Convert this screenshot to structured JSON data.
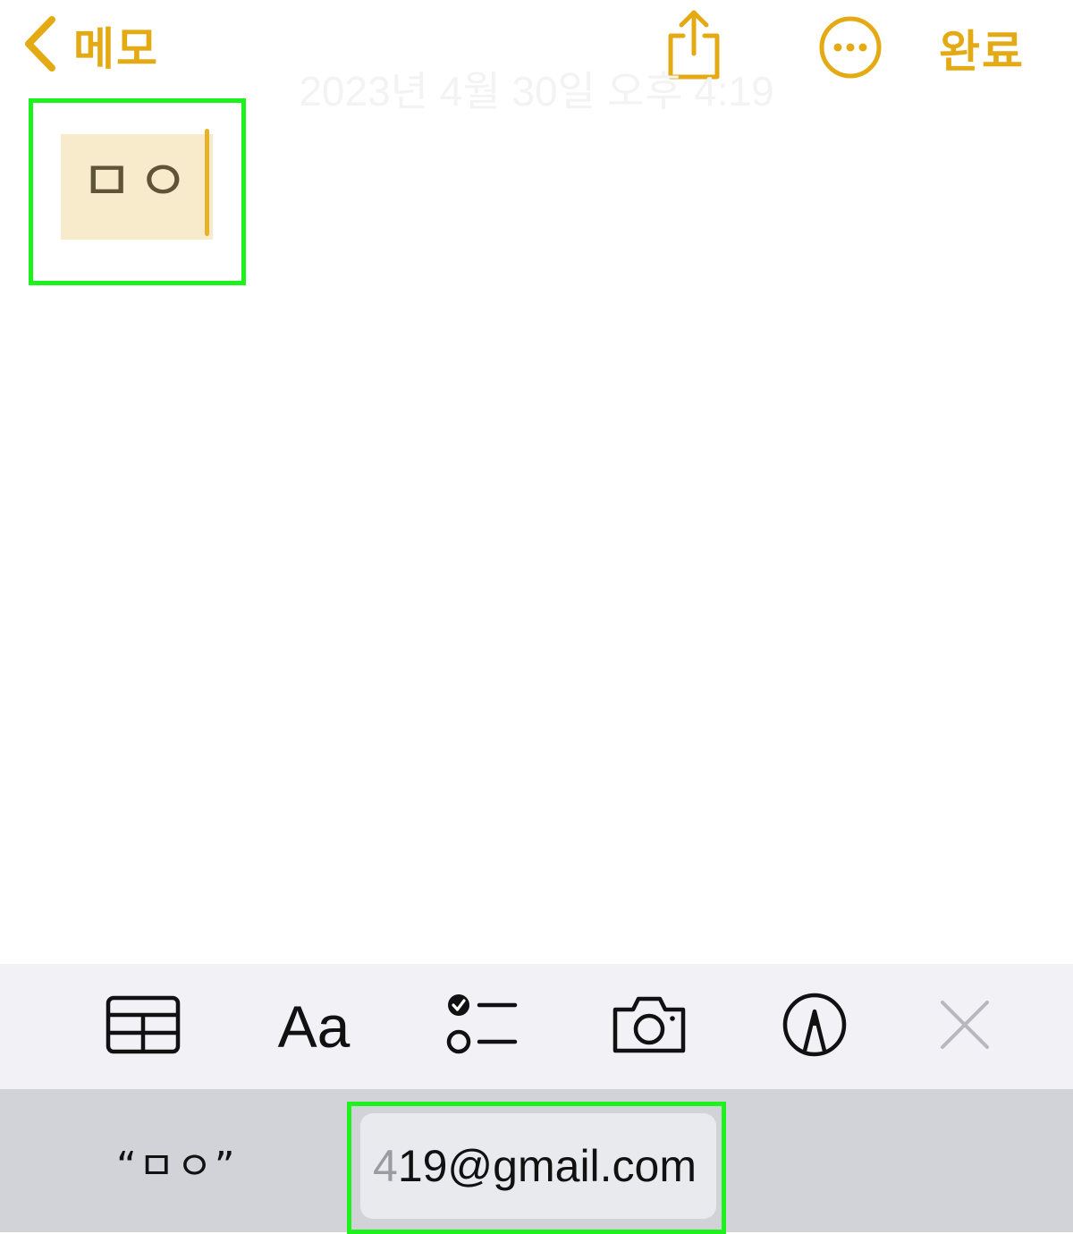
{
  "colors": {
    "accent": "#e3aa14",
    "highlight_fill": "#f8ebcb",
    "annotation_green": "#1df21d",
    "toolbar_bg": "#f1f1f6",
    "suggestion_bar_bg": "#d1d3d9"
  },
  "nav": {
    "back_label": "메모",
    "done_label": "완료",
    "back_icon": "chevron-left-icon",
    "share_icon": "share-icon",
    "more_icon": "ellipsis-circle-icon"
  },
  "note": {
    "date": "2023년 4월 30일 오후 4:19",
    "text": "ㅁㅇ"
  },
  "toolbar": {
    "items": [
      {
        "icon": "table-icon"
      },
      {
        "label": "Aa",
        "icon": "format-icon"
      },
      {
        "icon": "checklist-icon"
      },
      {
        "icon": "camera-icon"
      },
      {
        "icon": "markup-icon"
      },
      {
        "icon": "close-icon"
      }
    ]
  },
  "suggestions": {
    "left": "“ㅁㅇ”",
    "email_prefix": "4",
    "email": "19@gmail.com"
  }
}
